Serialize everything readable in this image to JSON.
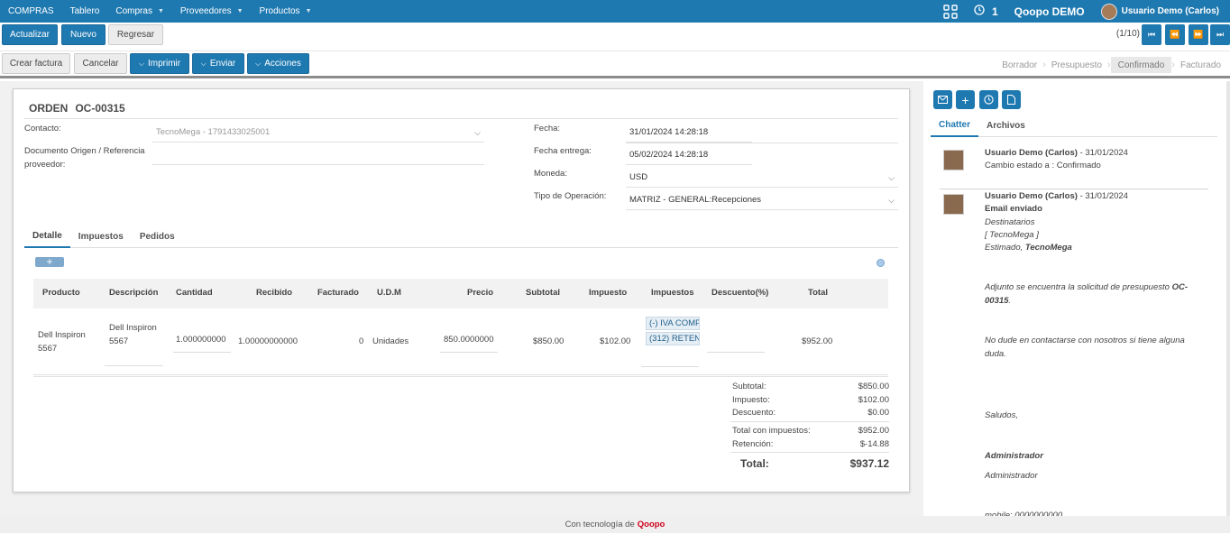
{
  "topnav": {
    "app_name": "COMPRAS",
    "menu": [
      {
        "label": "Tablero",
        "dropdown": false
      },
      {
        "label": "Compras",
        "dropdown": true
      },
      {
        "label": "Proveedores",
        "dropdown": true
      },
      {
        "label": "Productos",
        "dropdown": true
      }
    ],
    "activity_count": "1",
    "company": "Qoopo DEMO",
    "user": "Usuario Demo (Carlos)",
    "icons": [
      "apps-grid-icon",
      "clock-icon",
      "chevron-down-icon"
    ]
  },
  "toolbar": {
    "actualizar": "Actualizar",
    "nuevo": "Nuevo",
    "regresar": "Regresar",
    "pager": "(1/10)",
    "pager_icons": [
      "first-page-icon",
      "prev-page-icon",
      "next-page-icon",
      "last-page-icon"
    ]
  },
  "actions": {
    "crear_factura": "Crear factura",
    "cancelar": "Cancelar",
    "imprimir": "Imprimir",
    "enviar": "Enviar",
    "acciones": "Acciones"
  },
  "stages": [
    "Borrador",
    "Presupuesto",
    "Confirmado",
    "Facturado"
  ],
  "stage_active": "Confirmado",
  "form": {
    "title_prefix": "ORDEN",
    "title_number": "OC-00315",
    "contacto_label": "Contacto:",
    "contacto_value": "TecnoMega - 1791433025001",
    "docorigen_label_1": "Documento Origen / Referencia",
    "docorigen_label_2": "proveedor:",
    "fecha_label": "Fecha:",
    "fecha_value": "31/01/2024 14:28:18",
    "fecha_entrega_label": "Fecha entrega:",
    "fecha_entrega_value": "05/02/2024 14:28:18",
    "moneda_label": "Moneda:",
    "moneda_value": "USD",
    "tipo_op_label": "Tipo de Operación:",
    "tipo_op_value": "MATRIZ - GENERAL:Recepciones"
  },
  "tabs": [
    "Detalle",
    "Impuestos",
    "Pedidos"
  ],
  "table": {
    "headers": [
      "Producto",
      "Descripción",
      "Cantidad",
      "Recibido",
      "Facturado",
      "U.D.M",
      "Precio",
      "Subtotal",
      "Impuesto",
      "Impuestos",
      "Descuento(%)",
      "Total"
    ],
    "row": {
      "producto_1": "Dell Inspiron",
      "producto_2": "5567",
      "descripcion_1": "Dell Inspiron",
      "descripcion_2": "5567",
      "cantidad": "1.000000000",
      "recibido": "1.00000000000",
      "facturado": "0",
      "udm": "Unidades",
      "precio": "850.0000000",
      "subtotal": "$850.00",
      "impuesto": "$102.00",
      "impuestos_tags": [
        "(-) IVA COMP",
        "(312) RETEN"
      ],
      "descuento": "",
      "total": "$952.00"
    }
  },
  "totals": {
    "subtotal_label": "Subtotal:",
    "subtotal": "$850.00",
    "impuesto_label": "Impuesto:",
    "impuesto": "$102.00",
    "descuento_label": "Descuento:",
    "descuento": "$0.00",
    "total_impuestos_label": "Total con impuestos:",
    "total_impuestos": "$952.00",
    "retencion_label": "Retención:",
    "retencion": "$-14.88",
    "total_label": "Total:",
    "total": "$937.12"
  },
  "chatter": {
    "buttons": [
      "envelope-icon",
      "plus-icon",
      "clock-icon",
      "document-icon"
    ],
    "tabs": [
      "Chatter",
      "Archivos"
    ],
    "msg1": {
      "author": "Usuario Demo (Carlos)",
      "date": " - 31/01/2024",
      "text": "Cambio estado a : Confirmado"
    },
    "msg2": {
      "author": "Usuario Demo (Carlos)",
      "date": " - 31/01/2024",
      "subject": "Email enviado",
      "destinatarios": "Destinatarios",
      "dest_value": "[ TecnoMega ]",
      "estimado": "Estimado, ",
      "estimado_name": "TecnoMega",
      "adjunto": "Adjunto se encuentra la solicitud de presupuesto ",
      "adjunto_ref": "OC-00315",
      "adjunto_end": ".",
      "contacto": "No dude en contactarse con nosotros si tiene alguna duda.",
      "saludos": "Saludos,",
      "firma_bold": "Administrador",
      "firma": "Administrador",
      "mobile": "mobile: 0000000000"
    }
  },
  "footer": {
    "text": "Con tecnología de",
    "brand": "Qoopo"
  }
}
